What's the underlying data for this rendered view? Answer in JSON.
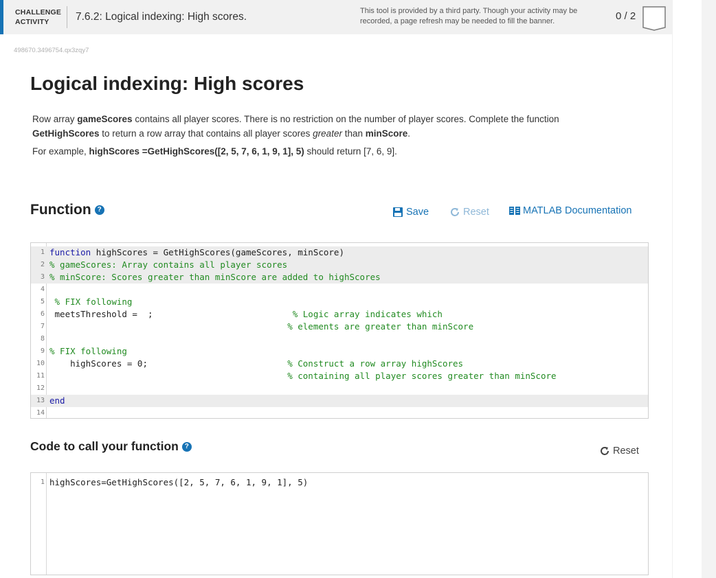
{
  "banner": {
    "type_line1": "CHALLENGE",
    "type_line2": "ACTIVITY",
    "title": "7.6.2: Logical indexing: High scores.",
    "notice": "This tool is provided by a third party. Though your activity may be recorded, a page refresh may be needed to fill the banner.",
    "score": "0 / 2",
    "accent_color": "#1773b5"
  },
  "activity_id": "498670.3496754.qx3zqy7",
  "heading": "Logical indexing: High scores",
  "description": {
    "p1_a": "Row array ",
    "p1_b": "gameScores",
    "p1_c": " contains all player scores. There is no restriction on the number of player scores. Complete the function ",
    "p1_d": "GetHighScores",
    "p1_e": " to return a row array that contains all player scores ",
    "p1_f": "greater",
    "p1_g": " than ",
    "p1_h": "minScore",
    "p1_i": ".",
    "p2_a": "For example,  ",
    "p2_b": "highScores =GetHighScores([2, 5, 7, 6, 1, 9, 1], 5)",
    "p2_c": " should return [7, 6, 9]."
  },
  "function_section": {
    "title": "Function",
    "help": "?",
    "save_label": "Save",
    "reset_label": "Reset",
    "docs_label": "MATLAB Documentation",
    "lines": [
      {
        "n": "1",
        "kw": "function",
        "text": " highScores = GetHighScores(gameScores, minScore)",
        "comment": "",
        "locked": true
      },
      {
        "n": "2",
        "kw": "",
        "text": "",
        "comment": "% gameScores: Array contains all player scores",
        "locked": true
      },
      {
        "n": "3",
        "kw": "",
        "text": "",
        "comment": "% minScore: Scores greater than minScore are added to highScores",
        "locked": true
      },
      {
        "n": "4",
        "kw": "",
        "text": "",
        "comment": "",
        "locked": false
      },
      {
        "n": "5",
        "kw": "",
        "text": " ",
        "comment": "% FIX following",
        "locked": false
      },
      {
        "n": "6",
        "kw": "",
        "text": " meetsThreshold =  ;                           ",
        "comment": "% Logic array indicates which",
        "locked": false
      },
      {
        "n": "7",
        "kw": "",
        "text": "                                              ",
        "comment": "% elements are greater than minScore",
        "locked": false
      },
      {
        "n": "8",
        "kw": "",
        "text": "",
        "comment": "",
        "locked": false
      },
      {
        "n": "9",
        "kw": "",
        "text": "",
        "comment": "% FIX following",
        "locked": false
      },
      {
        "n": "10",
        "kw": "",
        "text": "    highScores = 0;                           ",
        "comment": "% Construct a row array highScores",
        "locked": false
      },
      {
        "n": "11",
        "kw": "",
        "text": "                                              ",
        "comment": "% containing all player scores greater than minScore",
        "locked": false
      },
      {
        "n": "12",
        "kw": "",
        "text": "",
        "comment": "",
        "locked": false
      },
      {
        "n": "13",
        "kw": "end",
        "text": "",
        "comment": "",
        "locked": true
      },
      {
        "n": "14",
        "kw": "",
        "text": "",
        "comment": "",
        "locked": false
      }
    ]
  },
  "call_section": {
    "title": "Code to call your function",
    "help": "?",
    "reset_label": "Reset",
    "lines": [
      {
        "n": "1",
        "text": "highScores=GetHighScores([2, 5, 7, 6, 1, 9, 1], 5)"
      }
    ]
  }
}
